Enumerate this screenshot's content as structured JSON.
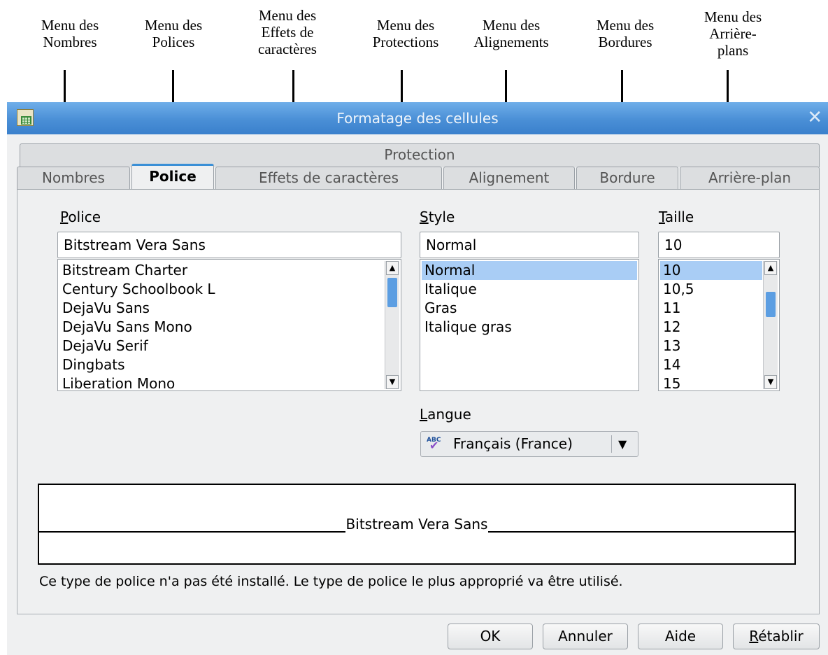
{
  "annotations": [
    {
      "text": "Menu des\nNombres"
    },
    {
      "text": "Menu des\nPolices"
    },
    {
      "text": "Menu des\nEffets de\ncaractères"
    },
    {
      "text": "Menu des\nProtections"
    },
    {
      "text": "Menu des\nAlignements"
    },
    {
      "text": "Menu des\nBordures"
    },
    {
      "text": "Menu des\nArrière-\nplans"
    }
  ],
  "dialog": {
    "title": "Formatage des cellules",
    "close_glyph": "✕"
  },
  "tabs": {
    "row1": [
      "Protection"
    ],
    "row2": [
      "Nombres",
      "Police",
      "Effets de caractères",
      "Alignement",
      "Bordure",
      "Arrière-plan"
    ],
    "active": "Police"
  },
  "font": {
    "label": "olice",
    "label_mnemonic": "P",
    "value": "Bitstream Vera Sans",
    "items": [
      "Bitstream Charter",
      "Century Schoolbook L",
      "DejaVu Sans",
      "DejaVu Sans Mono",
      "DejaVu Serif",
      "Dingbats",
      "Liberation Mono"
    ]
  },
  "style": {
    "label": "tyle",
    "label_mnemonic": "S",
    "value": "Normal",
    "items": [
      "Normal",
      "Italique",
      "Gras",
      "Italique gras"
    ],
    "selected": 0
  },
  "size": {
    "label": "aille",
    "label_mnemonic": "T",
    "value": "10",
    "items": [
      "10",
      "10,5",
      "11",
      "12",
      "13",
      "14",
      "15"
    ],
    "selected": 0
  },
  "language": {
    "label": "angue",
    "label_mnemonic": "L",
    "icon_text": "ABC",
    "value": "Français (France)"
  },
  "preview": {
    "text": "Bitstream Vera Sans"
  },
  "notice": "Ce type de police n'a pas été installé. Le type de police le plus approprié va être utilisé.",
  "buttons": {
    "ok": "OK",
    "cancel": "Annuler",
    "help": "Aide",
    "reset_mnemonic": "R",
    "reset_rest": "établir"
  },
  "colors": {
    "titlebar": "#4a8fd6",
    "selection": "#a9cdf5",
    "active_tab_accent": "#3a8fd6"
  }
}
